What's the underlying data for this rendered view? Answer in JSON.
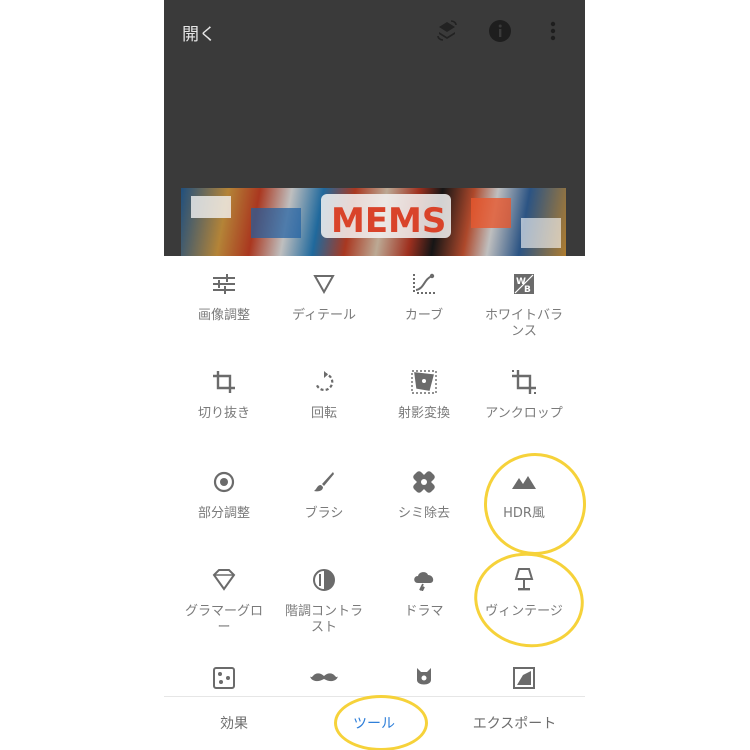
{
  "header": {
    "open_label": "開く",
    "icons": [
      "layers-stack-icon",
      "info-icon",
      "more-vert-icon"
    ]
  },
  "tools": [
    {
      "label": "画像調整",
      "icon": "tune-sliders-icon"
    },
    {
      "label": "ディテール",
      "icon": "triangle-down-icon"
    },
    {
      "label": "カーブ",
      "icon": "curves-icon"
    },
    {
      "label": "ホワイトバランス",
      "icon": "white-balance-icon"
    },
    {
      "label": "切り抜き",
      "icon": "crop-icon"
    },
    {
      "label": "回転",
      "icon": "rotate-icon"
    },
    {
      "label": "射影変換",
      "icon": "perspective-icon"
    },
    {
      "label": "アンクロップ",
      "icon": "expand-crop-icon"
    },
    {
      "label": "部分調整",
      "icon": "target-icon"
    },
    {
      "label": "ブラシ",
      "icon": "brush-icon"
    },
    {
      "label": "シミ除去",
      "icon": "healing-icon"
    },
    {
      "label": "HDR風",
      "icon": "mountain-icon"
    },
    {
      "label": "グラマーグロー",
      "icon": "diamond-icon"
    },
    {
      "label": "階調コントラスト",
      "icon": "tonal-contrast-icon"
    },
    {
      "label": "ドラマ",
      "icon": "cloud-drama-icon"
    },
    {
      "label": "ヴィンテージ",
      "icon": "lamp-icon"
    },
    {
      "label": "",
      "icon": "dice-icon"
    },
    {
      "label": "",
      "icon": "mustache-icon"
    },
    {
      "label": "",
      "icon": "guitar-icon"
    },
    {
      "label": "",
      "icon": "frame-icon"
    }
  ],
  "bottom_nav": {
    "effects": "効果",
    "tools": "ツール",
    "export": "エクスポート",
    "active": "tools"
  },
  "colors": {
    "topbar": "#3a3a3a",
    "active_tab": "#2f7fd9",
    "highlight": "#f6d23a",
    "icon": "#6b6b6b"
  }
}
